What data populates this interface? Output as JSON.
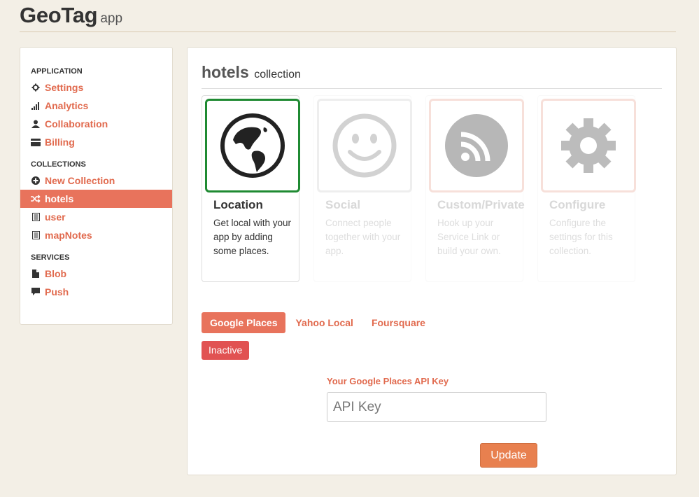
{
  "header": {
    "brand": "GeoTag",
    "brand_sub": "app"
  },
  "sidebar": {
    "sections": [
      {
        "title": "APPLICATION",
        "items": [
          {
            "label": "Settings",
            "icon": "gear-icon"
          },
          {
            "label": "Analytics",
            "icon": "bar-chart-icon"
          },
          {
            "label": "Collaboration",
            "icon": "user-icon"
          },
          {
            "label": "Billing",
            "icon": "credit-card-icon"
          }
        ]
      },
      {
        "title": "COLLECTIONS",
        "items": [
          {
            "label": "New Collection",
            "icon": "plus-circle-icon"
          },
          {
            "label": "hotels",
            "icon": "shuffle-icon",
            "active": true
          },
          {
            "label": "user",
            "icon": "list-icon"
          },
          {
            "label": "mapNotes",
            "icon": "list-icon"
          }
        ]
      },
      {
        "title": "SERVICES",
        "items": [
          {
            "label": "Blob",
            "icon": "file-icon"
          },
          {
            "label": "Push",
            "icon": "comment-icon"
          }
        ]
      }
    ]
  },
  "main": {
    "collection_name": "hotels",
    "collection_label": "collection",
    "cards": [
      {
        "title": "Location",
        "desc": "Get local with your app by adding some places.",
        "icon": "globe-icon",
        "state": "selected"
      },
      {
        "title": "Social",
        "desc": "Connect people together with your app.",
        "icon": "smiley-icon",
        "state": "faded"
      },
      {
        "title": "Custom/Private",
        "desc": "Hook up your Service Link or build your own.",
        "icon": "rss-icon",
        "state": "faded"
      },
      {
        "title": "Configure",
        "desc": "Configure the settings for this collection.",
        "icon": "gear-icon",
        "state": "faded"
      }
    ],
    "tabs": [
      {
        "label": "Google Places",
        "active": true
      },
      {
        "label": "Yahoo Local",
        "active": false
      },
      {
        "label": "Foursquare",
        "active": false
      }
    ],
    "status": "Inactive",
    "api_key_label": "Your Google Places API Key",
    "api_key_placeholder": "API Key",
    "api_key_value": "",
    "update_label": "Update"
  },
  "colors": {
    "accent": "#e8735c",
    "link": "#e16a4e",
    "selected_border": "#1f8a32",
    "inactive": "#e15252",
    "update": "#e8804f"
  }
}
